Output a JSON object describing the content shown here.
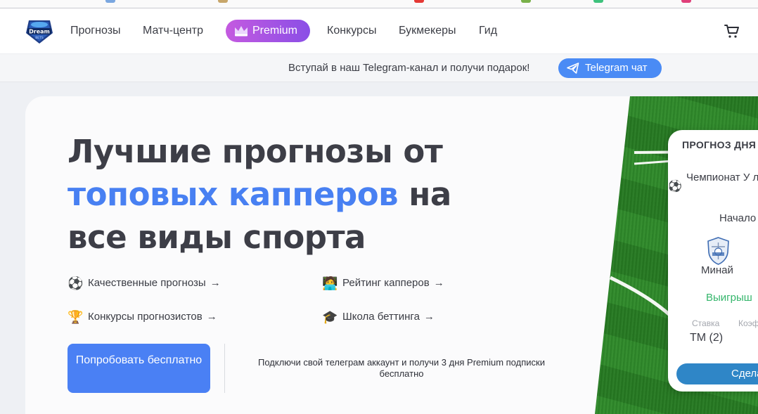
{
  "header": {
    "nav": [
      "Прогнозы",
      "Матч-центр",
      "Конкурсы",
      "Букмекеры",
      "Гид"
    ],
    "premium_label": "Premium",
    "logo_text": "Dream Bets",
    "cart_icon": "cart-icon"
  },
  "banner": {
    "text": "Вступай в наш Telegram-канал и получи подарок!",
    "button": "Telegram чат",
    "button_icon": "telegram-plane-icon"
  },
  "hero": {
    "title_line1": "Лучшие прогнозы от",
    "title_highlight": "топовых капперов",
    "title_line2_rest": " на",
    "title_line3": "все виды спорта",
    "features": [
      {
        "emoji": "⚽",
        "label": "Качественные прогнозы",
        "arrow": "→"
      },
      {
        "emoji": "🧑‍💻",
        "label": "Рейтинг капперов",
        "arrow": "→"
      },
      {
        "emoji": "🏆",
        "label": "Конкурсы прогнозистов",
        "arrow": "→"
      },
      {
        "emoji": "🎓",
        "label": "Школа беттинга",
        "arrow": "→"
      }
    ],
    "cta_label": "Попробовать бесплатно",
    "cta_note": "Подключи свой телеграм аккаунт и получи 3 дня Premium подписки бесплатно"
  },
  "forecast_card": {
    "title": "ПРОГНОЗ ДНЯ",
    "league": "Чемпионат У лига",
    "start_label": "Начало",
    "team": "Минай",
    "outcome": "Выигрыш",
    "stake_label": "Ставка",
    "coef_label": "Коэф",
    "stake_value": "ТМ (2)",
    "button": "Сдела"
  },
  "colors": {
    "accent": "#4880f2",
    "premium_start": "#c45ae0",
    "premium_end": "#8a4ee6",
    "win": "#35b66c",
    "card_button": "#2f86c7"
  }
}
